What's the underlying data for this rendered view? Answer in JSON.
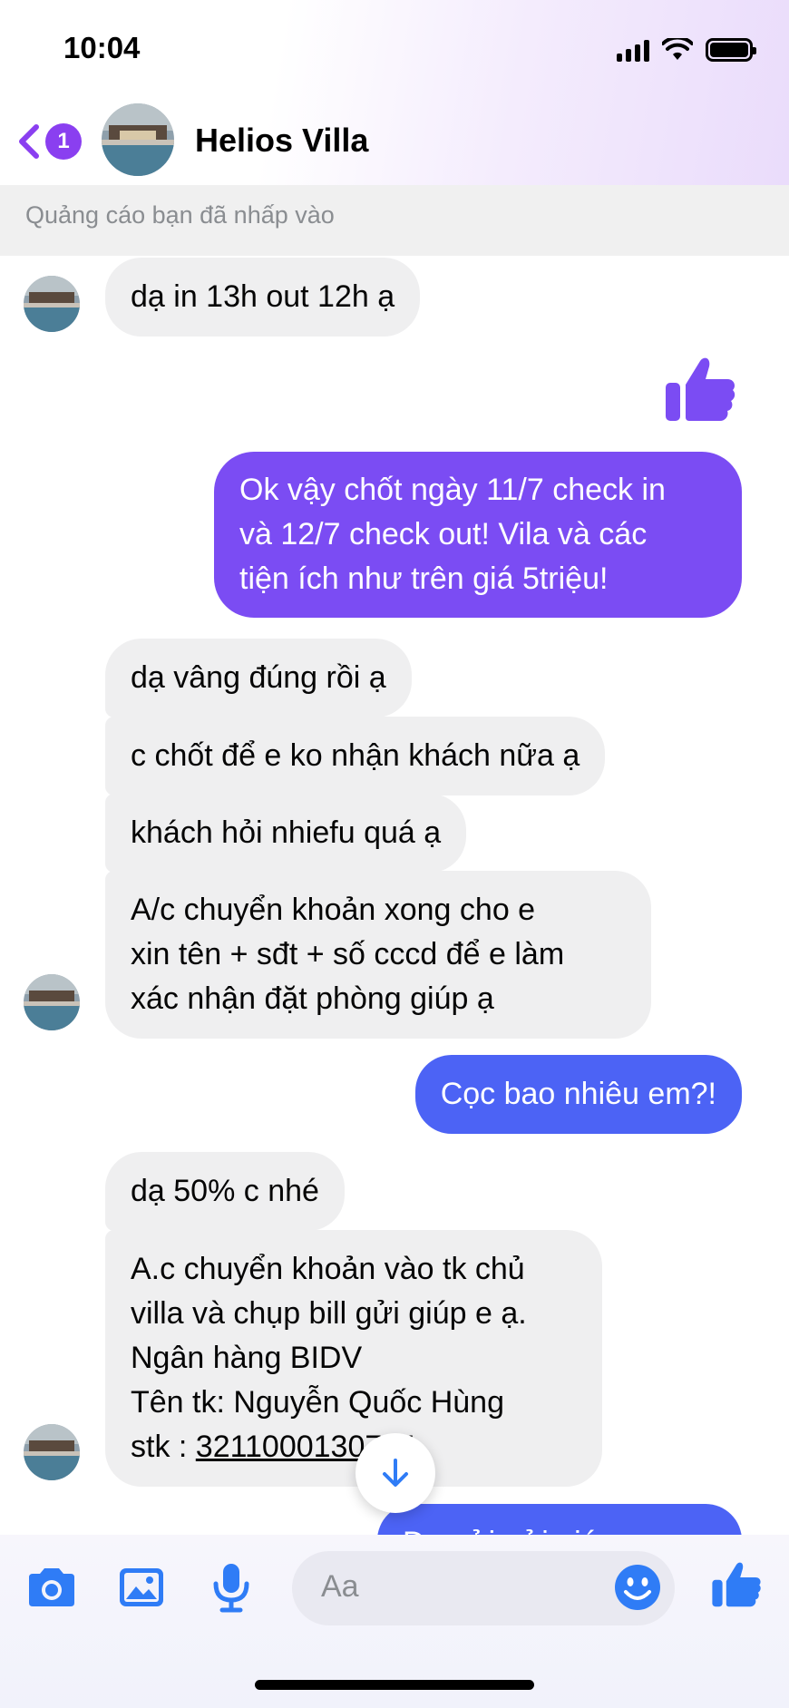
{
  "status_bar": {
    "time": "10:04"
  },
  "header": {
    "unread_count": "1",
    "contact_name": "Helios Villa"
  },
  "ad_banner": "Quảng cáo bạn đã nhấp vào",
  "messages": [
    {
      "from": "them",
      "text": "dạ in 13h out 12h ạ"
    },
    {
      "from": "me",
      "type": "like"
    },
    {
      "from": "me",
      "lines": [
        "Ok vậy chốt ngày 11/7 check in",
        "và 12/7 check out! Vila và các",
        "tiện ích như trên giá 5triệu!"
      ]
    },
    {
      "from": "them",
      "text": "dạ vâng đúng rồi ạ"
    },
    {
      "from": "them",
      "text": "c chốt để e ko nhận khách nữa ạ"
    },
    {
      "from": "them",
      "text": "khách hỏi nhiefu quá ạ"
    },
    {
      "from": "them",
      "lines": [
        "A/c chuyển khoản xong cho e",
        "xin tên + sđt + số cccd để e làm",
        "xác nhận đặt phòng giúp ạ"
      ]
    },
    {
      "from": "me",
      "text": "Cọc bao nhiêu em?!"
    },
    {
      "from": "them",
      "text": "dạ 50% c nhé"
    },
    {
      "from": "them",
      "lines": [
        "A.c chuyển khoản vào tk chủ",
        "villa và chụp bill gửi giúp e ạ.",
        "Ngân hàng BIDV",
        "Tên tk: Nguyễn Quốc Hùng",
        "stk : ",
        "3211000130784"
      ]
    },
    {
      "from": "me",
      "text": "Dạ gửi gửi giúp e..."
    }
  ],
  "composer": {
    "placeholder": "Aa"
  },
  "colors": {
    "accent_purple": "#7b4cf3",
    "accent_blue": "#4c63f5",
    "incoming_bg": "#efeff0",
    "icon_blue": "#2f7cf6"
  }
}
